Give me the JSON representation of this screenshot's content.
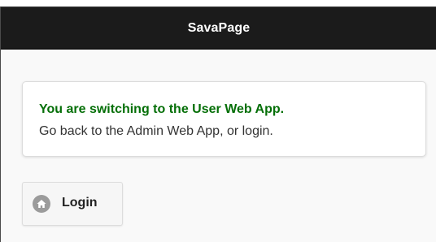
{
  "header": {
    "title": "SavaPage"
  },
  "message": {
    "title": "You are switching to the User Web App.",
    "text": "Go back to the Admin Web App, or login.",
    "title_color": "#056f08"
  },
  "login_button": {
    "label": "Login",
    "icon": "home-icon"
  },
  "colors": {
    "header_bg": "#1b1b1b",
    "page_bg": "#f9f9f9",
    "accent_green": "#056f08"
  }
}
